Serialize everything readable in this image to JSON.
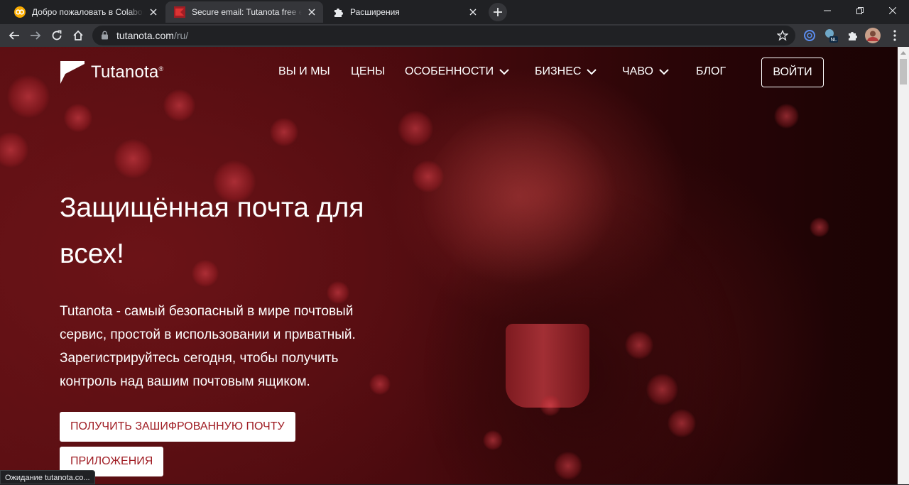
{
  "browser": {
    "tabs": [
      {
        "title": "Добро пожаловать в Colaboratory",
        "favicon": "colab-icon"
      },
      {
        "title": "Secure email: Tutanota free encrypted email",
        "favicon": "tutanota-icon"
      },
      {
        "title": "Расширения",
        "favicon": "puzzle-icon"
      }
    ],
    "active_tab": 1,
    "url_host": "tutanota.com",
    "url_path": "/ru/",
    "extensions": [
      "circle-extension-icon",
      "nl-extension-icon",
      "puzzle-icon",
      "avatar"
    ]
  },
  "site": {
    "logo_text": "Tutanota",
    "logo_reg": "®",
    "nav": {
      "about": "ВЫ И МЫ",
      "pricing": "ЦЕНЫ",
      "features": "ОСОБЕННОСТИ",
      "business": "БИЗНЕС",
      "faq": "ЧАВО",
      "blog": "БЛОГ"
    },
    "login": "ВОЙТИ",
    "hero_title": "Защищённая почта для всех!",
    "hero_text": "Tutanota - самый безопасный в мире почтовый сервис, простой в использовании и приватный. Зарегистрируйтесь сегодня, чтобы получить контроль над вашим почтовым ящиком.",
    "cta_primary": "ПОЛУЧИТЬ ЗАШИФРОВАННУЮ ПОЧТУ",
    "cta_secondary": "ПРИЛОЖЕНИЯ",
    "accent_color": "#a01d24"
  },
  "status": "Ожидание tutanota.co..."
}
